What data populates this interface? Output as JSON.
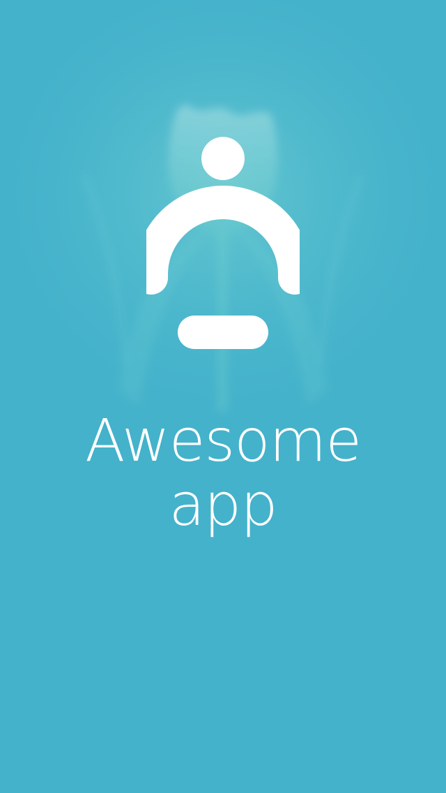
{
  "app": {
    "title_line1": "Awesome",
    "title_line2": "app"
  },
  "logo": {
    "icon": "person-meditation-icon",
    "color": "#ffffff"
  },
  "background": {
    "color": "#44b2cb",
    "image": "tulip-flower-photo"
  }
}
